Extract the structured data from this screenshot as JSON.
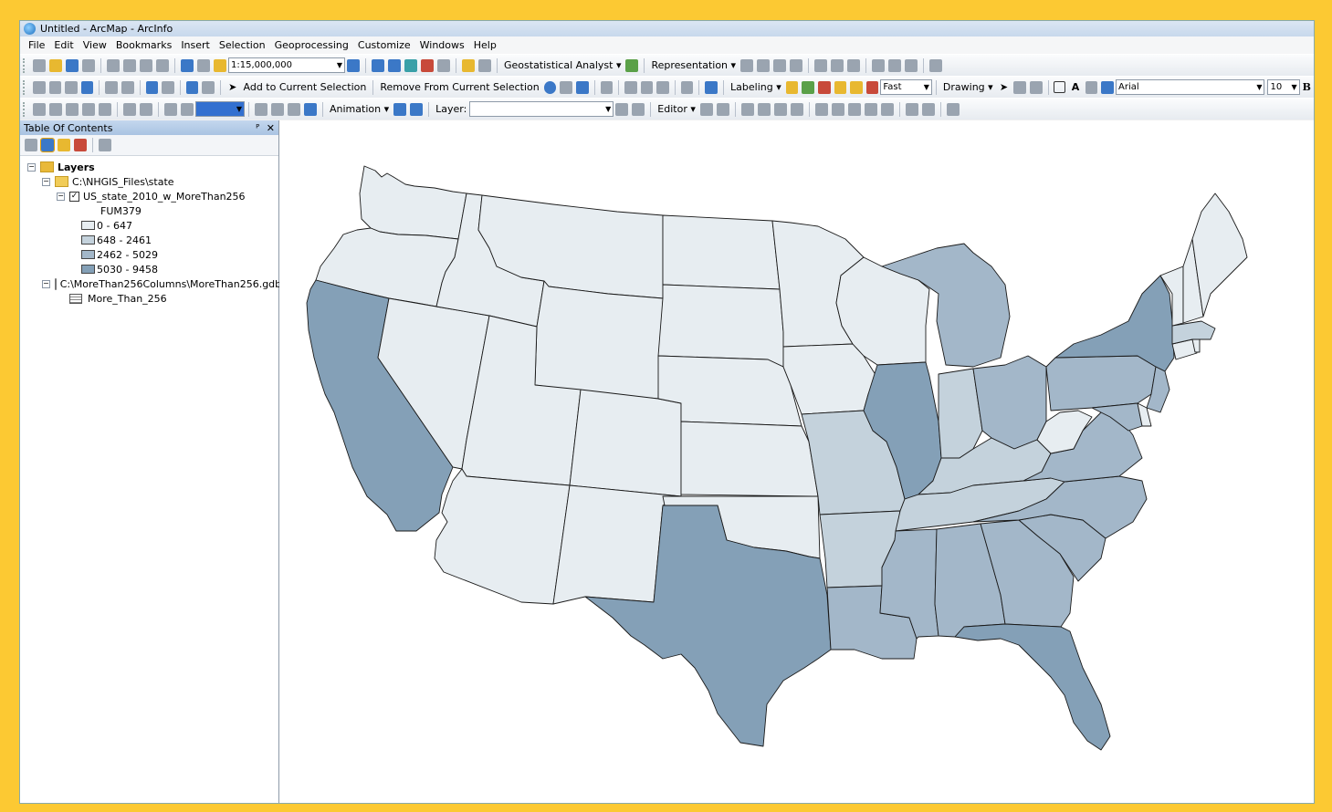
{
  "window": {
    "title": "Untitled - ArcMap - ArcInfo"
  },
  "menu": [
    "File",
    "Edit",
    "View",
    "Bookmarks",
    "Insert",
    "Selection",
    "Geoprocessing",
    "Customize",
    "Windows",
    "Help"
  ],
  "toolbar1": {
    "scale": "1:15,000,000",
    "geostat": "Geostatistical Analyst ▾",
    "representation": "Representation ▾"
  },
  "toolbar2": {
    "add_selection": "Add to Current Selection",
    "remove_selection": "Remove From Current Selection",
    "labeling": "Labeling ▾",
    "speed": "Fast",
    "drawing": "Drawing ▾",
    "font": "Arial",
    "font_size": "10",
    "bold": "B"
  },
  "toolbar3": {
    "animation": "Animation ▾",
    "layer_label": "Layer:",
    "editor": "Editor ▾"
  },
  "toc": {
    "title": "Table Of Contents",
    "pin": "ᴾ",
    "close": "✕",
    "layers_label": "Layers",
    "folder": "C:\\NHGIS_Files\\state",
    "layer": "US_state_2010_w_MoreThan256",
    "field": "FUM379",
    "legend": [
      {
        "label": "0 - 647",
        "color": "#e7edf1"
      },
      {
        "label": "648 - 2461",
        "color": "#c4d2dc"
      },
      {
        "label": "2462 - 5029",
        "color": "#a3b7c9"
      },
      {
        "label": "5030 - 9458",
        "color": "#84a0b7"
      }
    ],
    "gdb": "C:\\MoreThan256Columns\\MoreThan256.gdb",
    "table": "More_Than_256"
  },
  "map": {
    "classes": {
      "c1": "#e7edf1",
      "c2": "#c4d2dc",
      "c3": "#a3b7c9",
      "c4": "#84a0b7"
    }
  }
}
